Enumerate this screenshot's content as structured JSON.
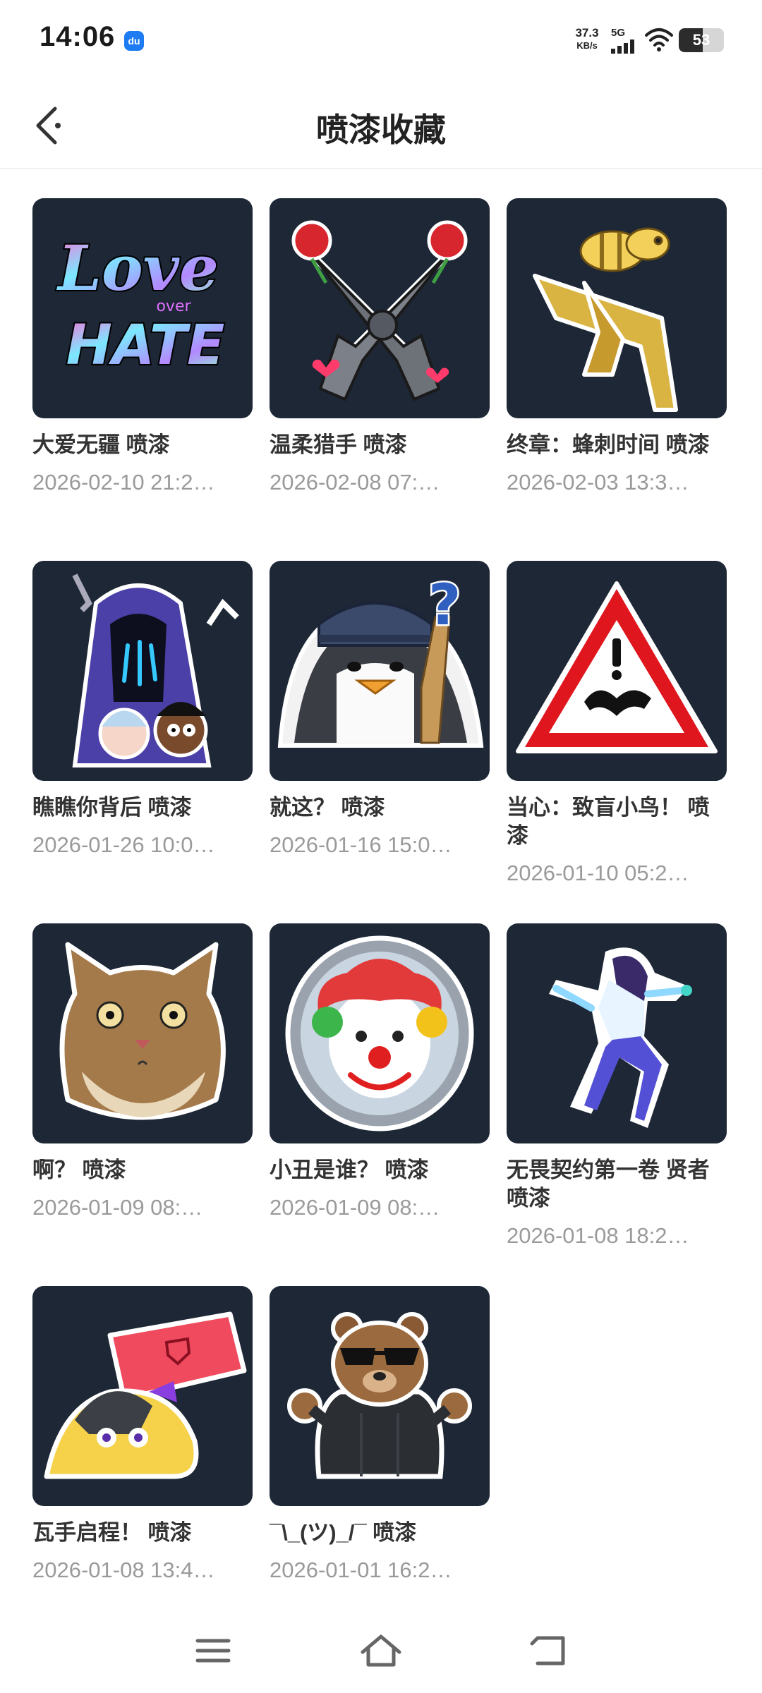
{
  "status_bar": {
    "time": "14:06",
    "app_badge": "du",
    "net_speed_value": "37.3",
    "net_speed_unit": "KB/s",
    "network_type": "5G",
    "battery_level": 53
  },
  "header": {
    "title": "喷漆收藏"
  },
  "items": [
    {
      "name": "大爱无疆 喷漆",
      "date": "2026-02-10 21:2…",
      "icon": "love-over-hate-graffiti"
    },
    {
      "name": "温柔猎手 喷漆",
      "date": "2026-02-08 07:…",
      "icon": "crossed-revolvers-roses"
    },
    {
      "name": "终章：蜂刺时间 喷漆",
      "date": "2026-02-03 13:3…",
      "icon": "golden-bee-gun"
    },
    {
      "name": "瞧瞧你背后 喷漆",
      "date": "2026-01-26 10:0…",
      "icon": "hooded-figure-surprise"
    },
    {
      "name": "就这？ 喷漆",
      "date": "2026-01-16 15:0…",
      "icon": "penguin-question"
    },
    {
      "name": "当心：致盲小鸟！ 喷漆",
      "date": "2026-01-10 05:2…",
      "icon": "warning-sign-bird"
    },
    {
      "name": "啊？ 喷漆",
      "date": "2026-01-09 08:…",
      "icon": "shocked-cat"
    },
    {
      "name": "小丑是谁？ 喷漆",
      "date": "2026-01-09 08:…",
      "icon": "clown-mirror"
    },
    {
      "name": "无畏契约第一卷 贤者 喷漆",
      "date": "2026-01-08 18:2…",
      "icon": "sage-agent"
    },
    {
      "name": "瓦手启程！ 喷漆",
      "date": "2026-01-08 13:4…",
      "icon": "bird-holding-phone"
    },
    {
      "name": "¯\\_(ツ)_/¯ 喷漆",
      "date": "2026-01-01 16:2…",
      "icon": "bear-sunglasses-shrug"
    }
  ],
  "colors": {
    "thumb_bg": "#1d2736",
    "title": "#222222",
    "date": "#9a9a9a"
  },
  "navbar": {
    "icons": [
      "menu-icon",
      "home-icon",
      "back-icon"
    ]
  }
}
